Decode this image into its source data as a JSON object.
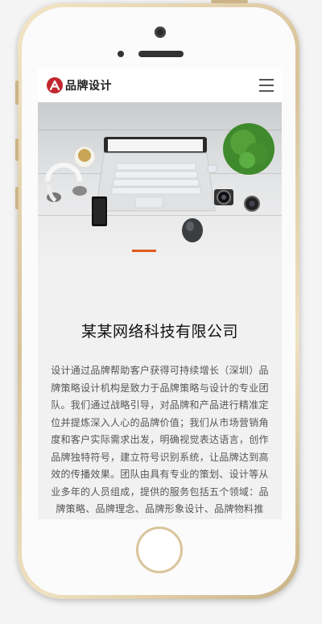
{
  "header": {
    "logo_letter": "A",
    "brand_name": "品牌设计",
    "menu_icon": "hamburger-menu-icon"
  },
  "banner": {
    "slide_count_indicator": "1"
  },
  "company": {
    "name": "某某网络科技有限公司",
    "intro": "设计通过品牌帮助客户获得可持续增长（深圳）品牌策略设计机构是致力于品牌策略与设计的专业团队。我们通过战略引导，对品牌和产品进行精准定位并提炼深入人心的品牌价值；我们从市场营销角度和客户实际需求出发，明确视觉表达语言，创作品牌独特符号，建立符号识别系统，让品牌达到高效的传播效果。团队由具有专业的策划、设计等从业多年的人员组成，提供的服务包括五个领域：品牌策略、品牌理念、品牌形象设计、品牌物料推广、品牌环境设计、品牌维度，服务于有着想做企业，以行业专业"
  },
  "colors": {
    "brand_red": "#c2272d",
    "indicator_orange": "#e15a1f",
    "phone_gold": "#d8c39a"
  }
}
